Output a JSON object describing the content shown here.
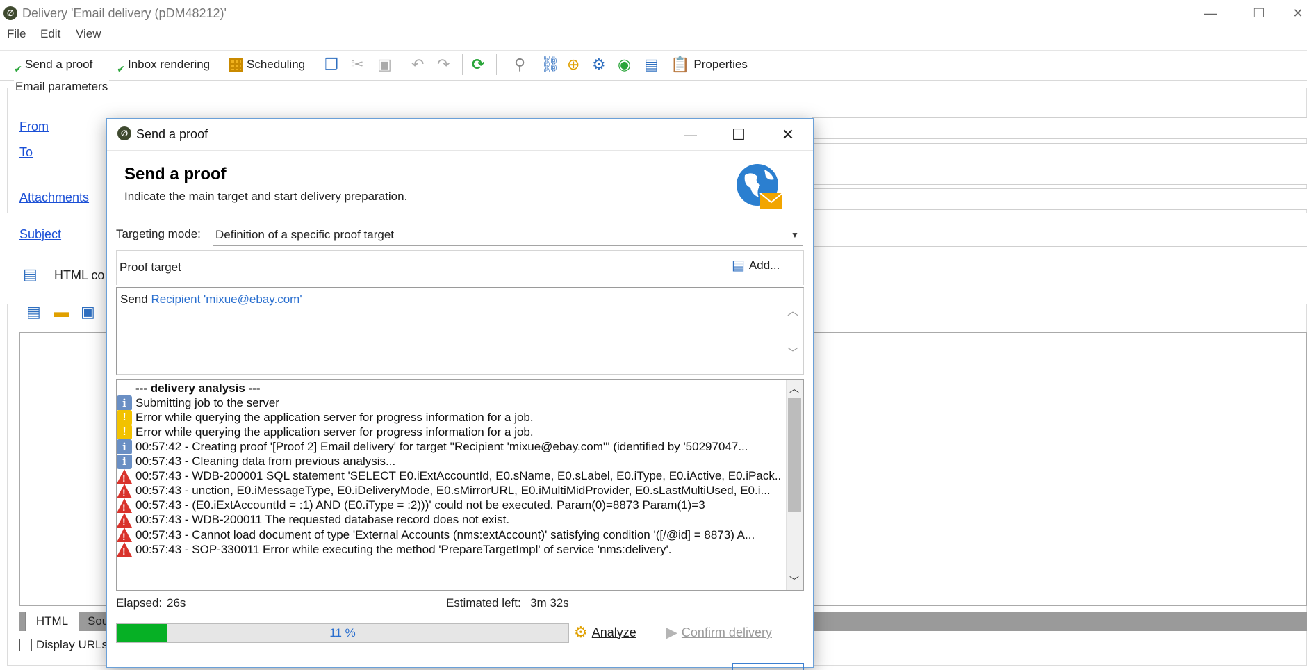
{
  "window": {
    "title": "Delivery 'Email delivery (pDM48212)'",
    "controls": {
      "minimize": "—",
      "restore": "❐",
      "close": "✕"
    }
  },
  "menu": [
    "File",
    "Edit",
    "View"
  ],
  "toolbar": {
    "send_proof": "Send a proof",
    "inbox_rendering": "Inbox rendering",
    "scheduling": "Scheduling",
    "properties": "Properties"
  },
  "email_params": {
    "legend": "Email parameters",
    "from": "From",
    "to": "To",
    "attachments": "Attachments",
    "subject": "Subject"
  },
  "content": {
    "html_content_label": "HTML co",
    "tab_html": "HTML",
    "tab_source": "Sou",
    "display_urls": "Display URLs"
  },
  "dialog": {
    "title": "Send a proof",
    "header_title": "Send a proof",
    "header_subtitle": "Indicate the main target and start delivery preparation.",
    "targeting_label": "Targeting mode:",
    "targeting_value": "Definition of a specific proof target",
    "proof_target_label": "Proof target",
    "add_label": "Add...",
    "recipient_prefix": "Send",
    "recipient_link": "Recipient 'mixue@ebay.com'",
    "log": [
      {
        "type": "header",
        "text": "--- delivery analysis ---"
      },
      {
        "type": "info",
        "text": "Submitting job to the server"
      },
      {
        "type": "warn",
        "text": "Error while querying the application server for progress information for a job."
      },
      {
        "type": "warn",
        "text": "Error while querying the application server for progress information for a job."
      },
      {
        "type": "info",
        "text": "00:57:42 - Creating proof '[Proof 2] Email delivery' for target ''Recipient 'mixue@ebay.com''' (identified by '50297047..."
      },
      {
        "type": "info",
        "text": "00:57:43 - Cleaning data from previous analysis..."
      },
      {
        "type": "error",
        "text": "00:57:43 - WDB-200001 SQL statement 'SELECT   E0.iExtAccountId, E0.sName, E0.sLabel, E0.iType, E0.iActive, E0.iPack..."
      },
      {
        "type": "error",
        "text": "00:57:43 - unction, E0.iMessageType, E0.iDeliveryMode, E0.sMirrorURL, E0.iMultiMidProvider, E0.sLastMultiUsed, E0.i..."
      },
      {
        "type": "error",
        "text": "00:57:43 - (E0.iExtAccountId = :1) AND (E0.iType = :2)))' could not be executed.   Param(0)=8873   Param(1)=3"
      },
      {
        "type": "error",
        "text": "00:57:43 - WDB-200011 The requested database record does not exist."
      },
      {
        "type": "error",
        "text": "00:57:43 - Cannot load document of type 'External Accounts (nms:extAccount)' satisfying condition '([/@id] = 8873) A..."
      },
      {
        "type": "error",
        "text": "00:57:43 - SOP-330011 Error while executing the method 'PrepareTargetImpl' of service 'nms:delivery'."
      }
    ],
    "elapsed_label": "Elapsed:",
    "elapsed_value": "26s",
    "estimated_label": "Estimated left:",
    "estimated_value": "3m  32s",
    "progress_percent": 11,
    "progress_text": "11 %",
    "analyze_label": "Analyze",
    "confirm_label": "Confirm delivery",
    "close_glyph": "✕",
    "maximize_glyph": "☐",
    "minimize_glyph": "—"
  },
  "colors": {
    "link": "#1a4fd6",
    "progress_fill": "#06b025",
    "error": "#d9322b",
    "warning": "#f2c200",
    "info": "#6a8fc4"
  }
}
